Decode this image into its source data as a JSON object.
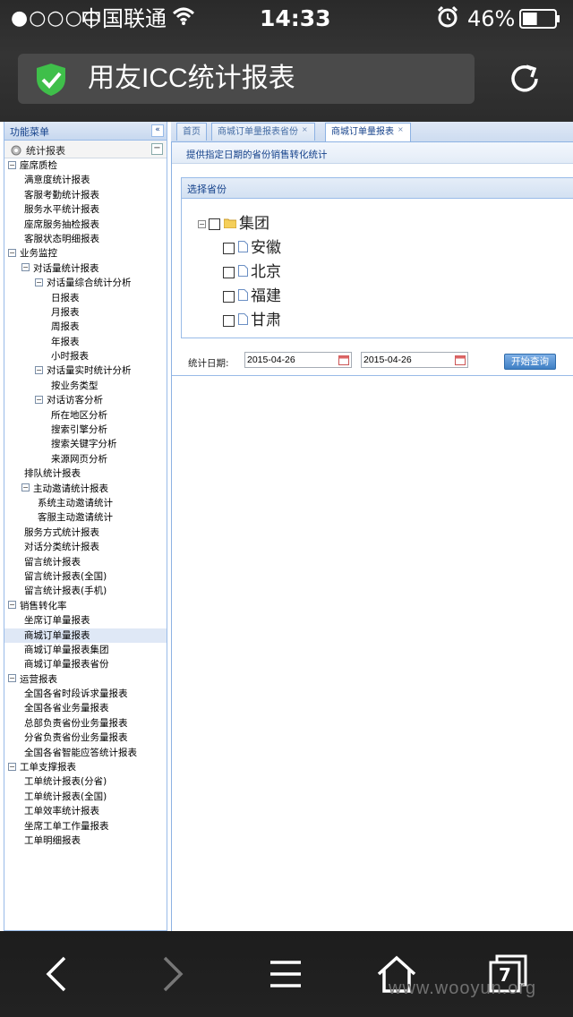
{
  "status_bar": {
    "signal": "●○○○○",
    "carrier": "中国联通",
    "time": "14:33",
    "battery_percent": "46%",
    "battery_level": 0.46
  },
  "browser": {
    "page_title": "用友ICC统计报表",
    "secure_icon": "green-shield-check-icon",
    "reload_icon": "reload-icon",
    "watermark": "www.wooyun.org",
    "tabs_count": "7"
  },
  "left_panel": {
    "title": "功能菜单",
    "collapse_icon": "«",
    "section_title": "统计报表",
    "section_toggle": "−",
    "tree": [
      {
        "label": "座席质检",
        "level": 0,
        "expander": "−"
      },
      {
        "label": "满意度统计报表",
        "level": 2
      },
      {
        "label": "客服考勤统计报表",
        "level": 2
      },
      {
        "label": "服务水平统计报表",
        "level": 2
      },
      {
        "label": "座席服务抽检报表",
        "level": 2
      },
      {
        "label": "客服状态明细报表",
        "level": 2
      },
      {
        "label": "业务监控",
        "level": 0,
        "expander": "−"
      },
      {
        "label": "对话量统计报表",
        "level": 1,
        "expander": "−"
      },
      {
        "label": "对话量综合统计分析",
        "level": 2,
        "expander": "−"
      },
      {
        "label": "日报表",
        "level": 4
      },
      {
        "label": "月报表",
        "level": 4
      },
      {
        "label": "周报表",
        "level": 4
      },
      {
        "label": "年报表",
        "level": 4
      },
      {
        "label": "小时报表",
        "level": 4
      },
      {
        "label": "对话量实时统计分析",
        "level": 2,
        "expander": "−"
      },
      {
        "label": "按业务类型",
        "level": 4
      },
      {
        "label": "对话访客分析",
        "level": 2,
        "expander": "−"
      },
      {
        "label": "所在地区分析",
        "level": 4
      },
      {
        "label": "搜索引擎分析",
        "level": 4
      },
      {
        "label": "搜索关键字分析",
        "level": 4
      },
      {
        "label": "来源网页分析",
        "level": 4
      },
      {
        "label": "排队统计报表",
        "level": 2
      },
      {
        "label": "主动邀请统计报表",
        "level": 1,
        "expander": "−"
      },
      {
        "label": "系统主动邀请统计",
        "level": 3
      },
      {
        "label": "客服主动邀请统计",
        "level": 3
      },
      {
        "label": "服务方式统计报表",
        "level": 2
      },
      {
        "label": "对话分类统计报表",
        "level": 2
      },
      {
        "label": "留言统计报表",
        "level": 2
      },
      {
        "label": "留言统计报表(全国)",
        "level": 2
      },
      {
        "label": "留言统计报表(手机)",
        "level": 2
      },
      {
        "label": "销售转化率",
        "level": 0,
        "expander": "−"
      },
      {
        "label": "坐席订单量报表",
        "level": 2
      },
      {
        "label": "商城订单量报表",
        "level": 2,
        "selected": true
      },
      {
        "label": "商城订单量报表集团",
        "level": 2
      },
      {
        "label": "商城订单量报表省份",
        "level": 2
      },
      {
        "label": "运营报表",
        "level": 0,
        "expander": "−"
      },
      {
        "label": "全国各省时段诉求量报表",
        "level": 2
      },
      {
        "label": "全国各省业务量报表",
        "level": 2
      },
      {
        "label": "总部负责省份业务量报表",
        "level": 2
      },
      {
        "label": "分省负责省份业务量报表",
        "level": 2
      },
      {
        "label": "全国各省智能应答统计报表",
        "level": 2
      },
      {
        "label": "工单支撑报表",
        "level": 0,
        "expander": "−"
      },
      {
        "label": "工单统计报表(分省)",
        "level": 2
      },
      {
        "label": "工单统计报表(全国)",
        "level": 2
      },
      {
        "label": "工单效率统计报表",
        "level": 2
      },
      {
        "label": "坐席工单工作量报表",
        "level": 2
      },
      {
        "label": "工单明细报表",
        "level": 2
      }
    ]
  },
  "tabs": [
    {
      "label": "首页",
      "closable": false,
      "active": false
    },
    {
      "label": "商城订单量报表省份",
      "closable": true,
      "active": false
    },
    {
      "label": "商城订单量报表",
      "closable": true,
      "active": true
    }
  ],
  "tab_close_glyph": "×",
  "content": {
    "description": "提供指定日期的省份销售转化统计",
    "province_panel": {
      "title": "选择省份",
      "root": {
        "label": "集团",
        "expander": "−"
      },
      "provinces": [
        "安徽",
        "北京",
        "福建",
        "甘肃"
      ]
    },
    "date_label": "统计日期:",
    "start_date": "2015-04-26",
    "end_date": "2015-04-26",
    "query_button": "开始查询"
  }
}
